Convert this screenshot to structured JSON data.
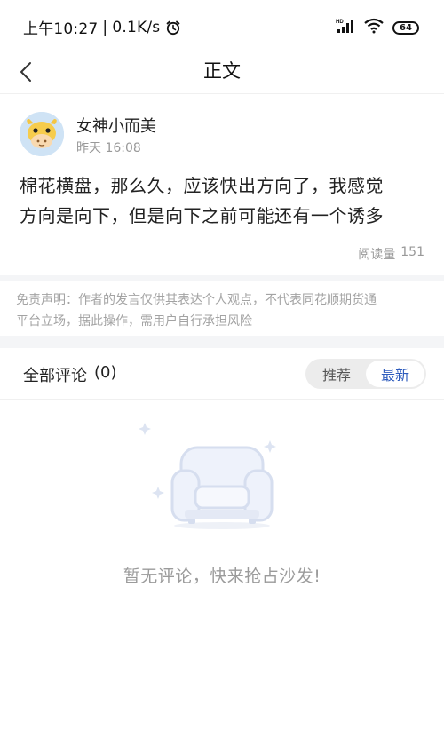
{
  "status_bar": {
    "time": "上午10:27",
    "separator": "|",
    "speed": "0.1K/s",
    "alarm_icon": "alarm-icon",
    "hd_label": "HD",
    "battery": "64"
  },
  "nav": {
    "title": "正文",
    "back_icon": "chevron-left-icon"
  },
  "post": {
    "author": "女神小而美",
    "time": "昨天 16:08",
    "body_line1": "棉花横盘，那么久，应该快出方向了，我感觉",
    "body_line2": "方向是向下，但是向下之前可能还有一个诱多",
    "read_label": "阅读量",
    "read_count": "151"
  },
  "disclaimer": {
    "line1": "免责声明：作者的发言仅供其表达个人观点，不代表同花顺期货通",
    "line2": "平台立场，据此操作，需用户自行承担风险"
  },
  "comments": {
    "title": "全部评论",
    "count": "(0)",
    "sort_options": [
      "推荐",
      "最新"
    ],
    "active_sort": "最新",
    "empty_text": "暂无评论，快来抢占沙发!"
  },
  "colors": {
    "accent": "#2d5bbd",
    "muted": "#999999",
    "divider": "#f4f5f7"
  }
}
